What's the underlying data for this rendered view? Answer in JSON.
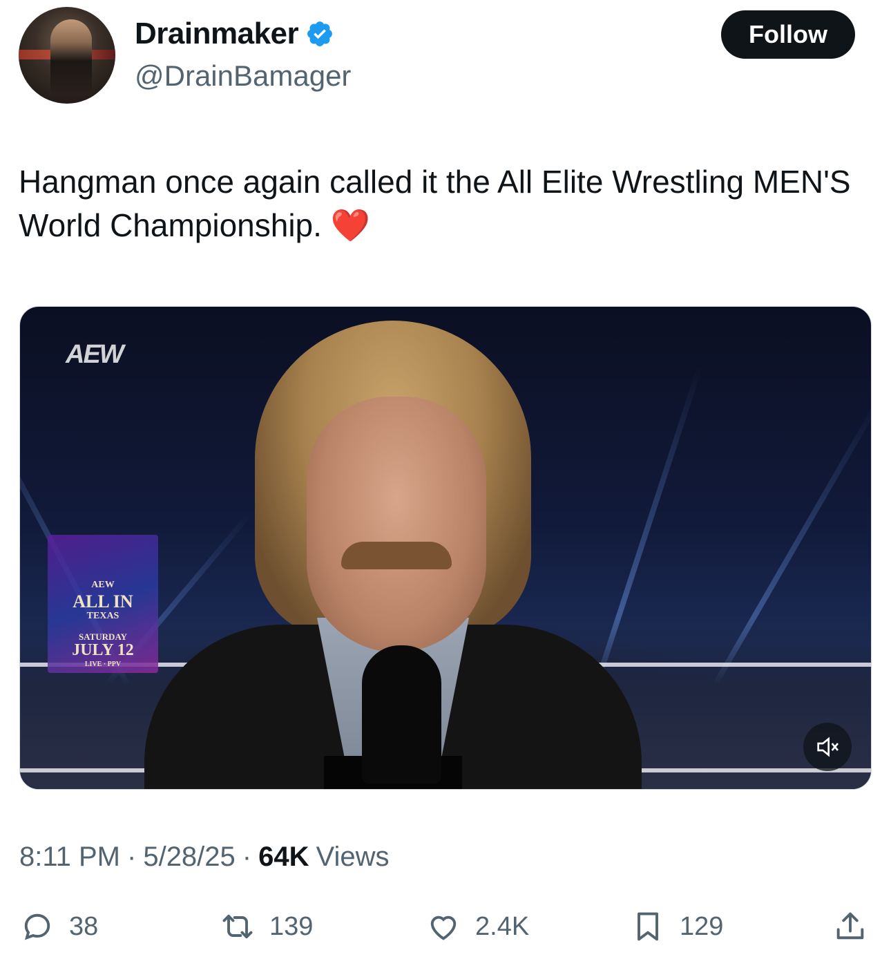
{
  "author": {
    "display_name": "Drainmaker",
    "handle": "@DrainBamager",
    "verified": true
  },
  "follow_label": "Follow",
  "tweet": {
    "text": "Hangman once again called it the All Elite Wrestling MEN'S World Championship.",
    "emoji": "❤️"
  },
  "media": {
    "type": "video",
    "muted": true,
    "overlay_logo": "AEW",
    "sign": {
      "brand": "AEW",
      "title": "ALL IN",
      "location": "TEXAS",
      "day": "SATURDAY",
      "date": "JULY 12",
      "footer": "LIVE · PPV"
    }
  },
  "meta": {
    "time": "8:11 PM",
    "separator": "·",
    "date": "5/28/25",
    "views_count": "64K",
    "views_label": "Views"
  },
  "actions": {
    "replies": "38",
    "reposts": "139",
    "likes": "2.4K",
    "bookmarks": "129"
  },
  "colors": {
    "text_primary": "#0f1419",
    "text_secondary": "#536471",
    "verified_blue": "#1d9bf0",
    "button_dark": "#0f1419"
  }
}
